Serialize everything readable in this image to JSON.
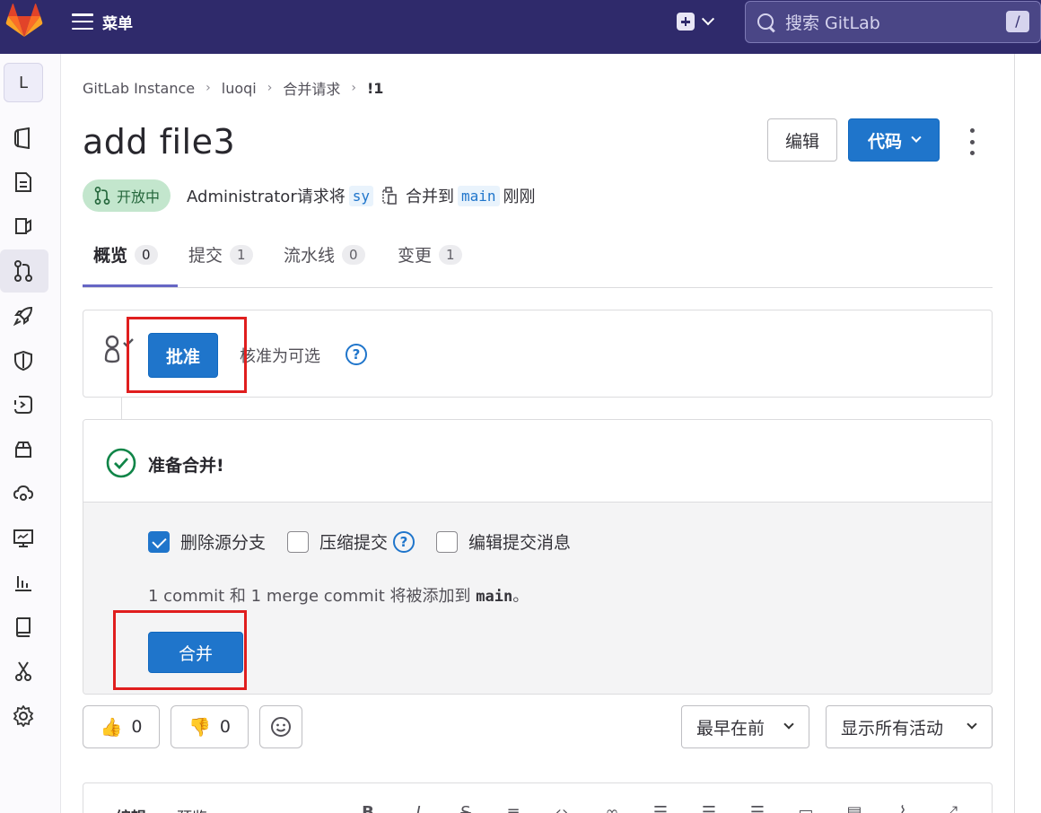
{
  "topbar": {
    "menu_label": "菜单",
    "search_placeholder": "搜索 GitLab",
    "search_shortcut": "/"
  },
  "sidebar": {
    "project_initial": "L",
    "items": [
      {
        "icon": "project-icon"
      },
      {
        "icon": "issues-icon"
      },
      {
        "icon": "boards-icon"
      },
      {
        "icon": "merge-request-icon",
        "active": true
      },
      {
        "icon": "rocket-icon"
      },
      {
        "icon": "shield-icon"
      },
      {
        "icon": "deployments-icon"
      },
      {
        "icon": "package-icon"
      },
      {
        "icon": "infrastructure-icon"
      },
      {
        "icon": "monitor-icon"
      },
      {
        "icon": "analytics-icon"
      },
      {
        "icon": "wiki-icon"
      },
      {
        "icon": "snippets-icon"
      },
      {
        "icon": "settings-icon"
      }
    ]
  },
  "breadcrumb": [
    "GitLab Instance",
    "luoqi",
    "合并请求",
    "!1"
  ],
  "page": {
    "title": "add file3",
    "edit_label": "编辑",
    "code_label": "代码"
  },
  "meta": {
    "status": "开放中",
    "author_prefix": "Administrator请求将",
    "source_branch": "sy",
    "merge_to": "合并到",
    "target_branch": "main",
    "time": "刚刚"
  },
  "tabs": [
    {
      "label": "概览",
      "count": "0",
      "active": true
    },
    {
      "label": "提交",
      "count": "1"
    },
    {
      "label": "流水线",
      "count": "0"
    },
    {
      "label": "变更",
      "count": "1"
    }
  ],
  "approval": {
    "button": "批准",
    "text": "核准为可选",
    "help": "?"
  },
  "merge": {
    "ready": "准备合并!",
    "options": [
      {
        "label": "删除源分支",
        "checked": true
      },
      {
        "label": "压缩提交",
        "checked": false,
        "help": "?"
      },
      {
        "label": "编辑提交消息",
        "checked": false
      }
    ],
    "commit_info_prefix": "1 commit 和 1 merge commit 将被添加到 ",
    "commit_info_branch": "main",
    "commit_info_suffix": "。",
    "button": "合并"
  },
  "reactions": {
    "thumbs_up": "0",
    "thumbs_down": "0"
  },
  "activity": {
    "sort": "最早在前",
    "filter": "显示所有活动"
  },
  "editor": {
    "tab_write": "编辑",
    "tab_preview": "预览"
  },
  "colors": {
    "topbar": "#2f2a6b",
    "primary": "#1f75cb",
    "highlight": "#e01e1e",
    "success": "#108548"
  }
}
